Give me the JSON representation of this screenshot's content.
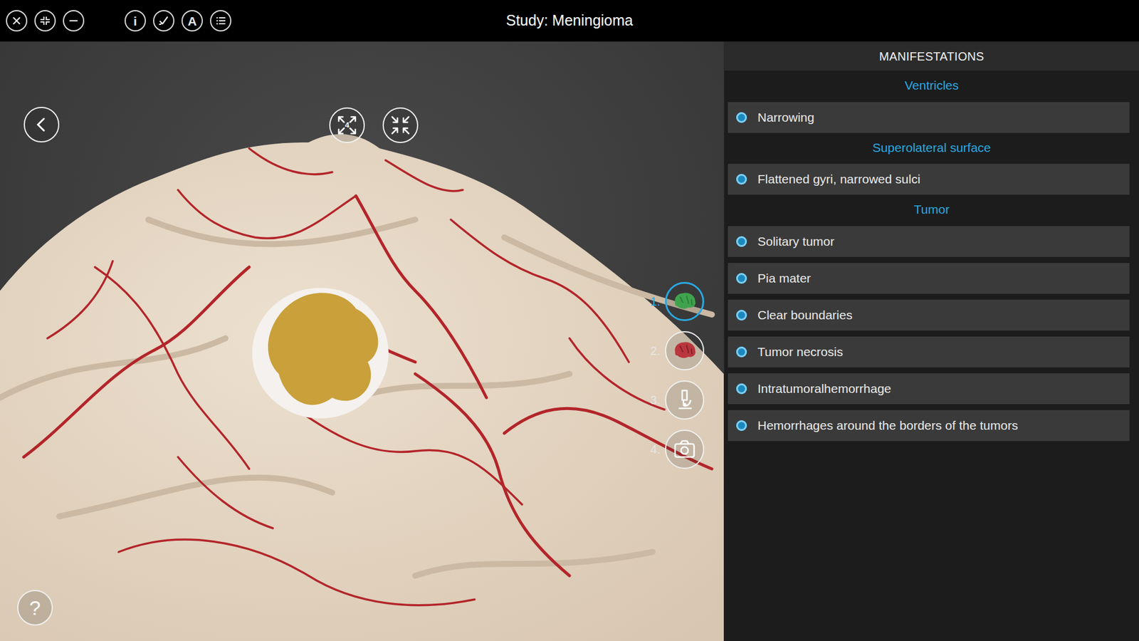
{
  "window": {
    "title": "Study: Meningioma"
  },
  "toolbar": {
    "info": "i",
    "font": "A"
  },
  "viewport": {
    "zoom_label": "4",
    "modes": [
      {
        "label": "1.",
        "selected": true
      },
      {
        "label": "2.",
        "selected": false
      },
      {
        "label": "3.",
        "selected": false
      },
      {
        "label": "4.",
        "selected": false
      }
    ],
    "help": "?"
  },
  "panel": {
    "title": "MANIFESTATIONS",
    "sections": [
      {
        "title": "Ventricles",
        "items": [
          {
            "label": "Narrowing",
            "checked": true
          }
        ]
      },
      {
        "title": "Superolateral surface",
        "items": [
          {
            "label": "Flattened gyri, narrowed sulci",
            "checked": true
          }
        ]
      },
      {
        "title": "Tumor",
        "items": [
          {
            "label": "Solitary tumor",
            "checked": true
          },
          {
            "label": "Pia mater",
            "checked": true
          },
          {
            "label": "Clear boundaries",
            "checked": true
          },
          {
            "label": "Tumor necrosis",
            "checked": true
          },
          {
            "label": "Intratumoralhemorrhage",
            "checked": true
          },
          {
            "label": "Hemorrhages around the borders of the tumors",
            "checked": true
          }
        ]
      }
    ]
  }
}
